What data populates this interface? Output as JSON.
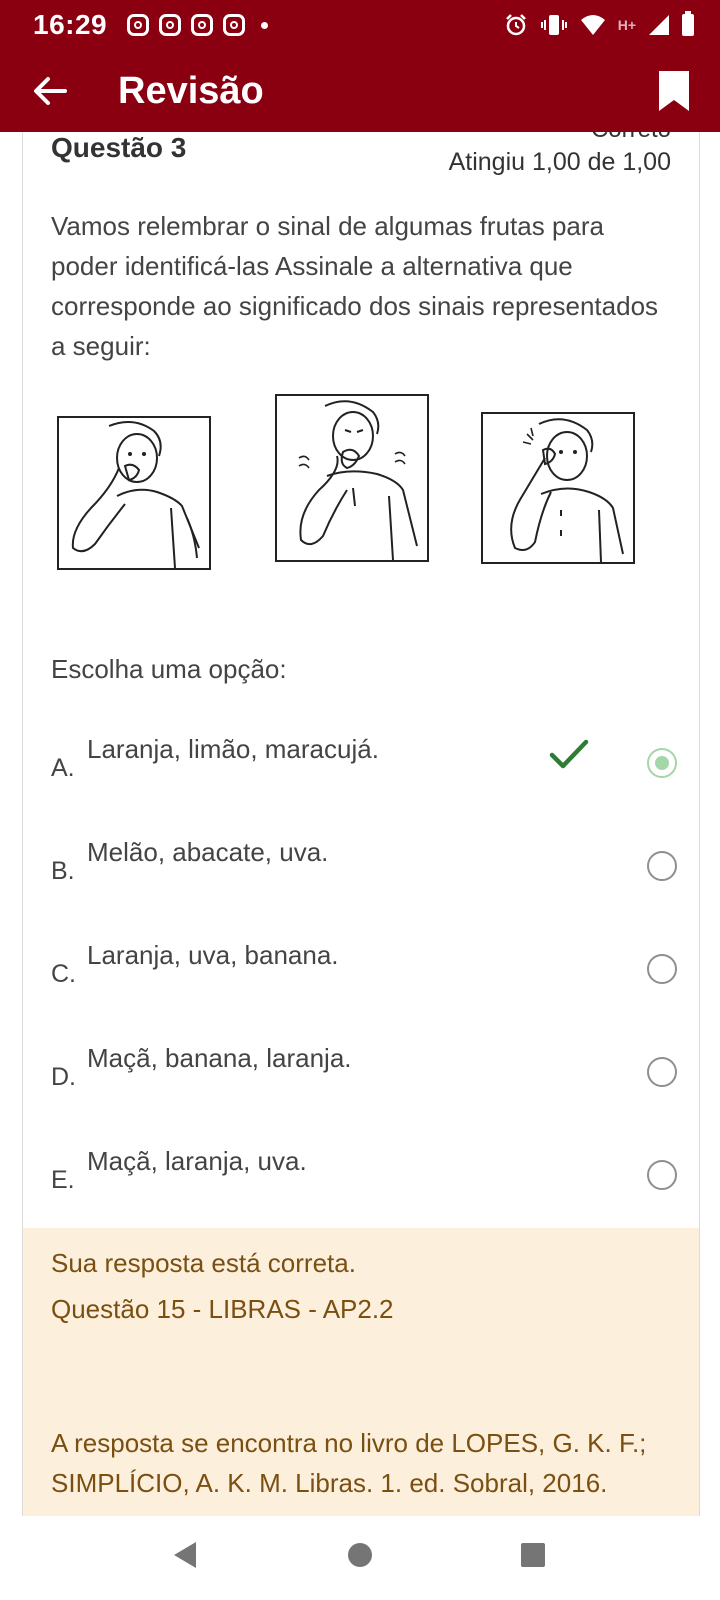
{
  "status_bar": {
    "time": "16:29",
    "notifications": [
      "instagram-icon",
      "instagram-icon",
      "instagram-icon",
      "instagram-icon",
      "more-dot"
    ],
    "network_label": "H+",
    "system_icons": [
      "alarm-icon",
      "vibrate-icon",
      "wifi-icon",
      "signal-icon",
      "battery-icon"
    ]
  },
  "app_bar": {
    "title": "Revisão",
    "back_icon": "arrow-left-icon",
    "bookmark_icon": "bookmark-icon"
  },
  "question": {
    "number_label": "Questão 3",
    "status_label": "Correto",
    "grade_label": "Atingiu 1,00 de 1,00",
    "text": "Vamos relembrar o sinal de algumas frutas para poder identificá-las Assinale a alternativa que corresponde ao significado dos sinais representados a seguir:",
    "choose_label": "Escolha uma opção:",
    "options": [
      {
        "letter": "A.",
        "text": "Laranja, limão, maracujá.",
        "selected": true,
        "correct": true
      },
      {
        "letter": "B.",
        "text": "Melão, abacate, uva.",
        "selected": false
      },
      {
        "letter": "C.",
        "text": "Laranja, uva, banana.",
        "selected": false
      },
      {
        "letter": "D.",
        "text": "Maçã, banana, laranja.",
        "selected": false
      },
      {
        "letter": "E.",
        "text": "Maçã, laranja, uva.",
        "selected": false
      }
    ]
  },
  "feedback": {
    "result": "Sua resposta está correta.",
    "source": "Questão 15 - LIBRAS - AP2.2",
    "reference_line1": "A resposta se encontra no livro de LOPES, G. K. F.;",
    "reference_line2": "SIMPLÍCIO, A. K. M. Libras. 1. ed. Sobral, 2016."
  },
  "colors": {
    "primary": "#8a0011",
    "feedback_bg": "#fcefdc",
    "feedback_text": "#7a4f11",
    "correct_green": "#2e7d32"
  },
  "nav_bar": [
    "back-triangle-icon",
    "home-circle-icon",
    "recents-square-icon"
  ]
}
